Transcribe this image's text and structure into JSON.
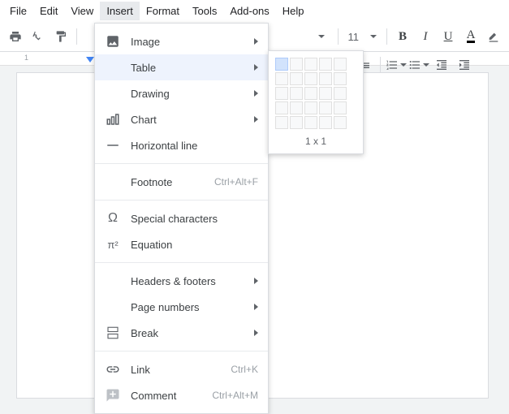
{
  "menubar": [
    "File",
    "Edit",
    "View",
    "Insert",
    "Format",
    "Tools",
    "Add-ons",
    "Help"
  ],
  "active_menu_index": 3,
  "toolbar": {
    "font_size": "11"
  },
  "insert_menu": {
    "items": [
      {
        "icon": "image",
        "label": "Image",
        "submenu": true
      },
      {
        "icon": "table",
        "label": "Table",
        "submenu": true,
        "highlight": true
      },
      {
        "icon": "drawing",
        "label": "Drawing",
        "submenu": true
      },
      {
        "icon": "chart",
        "label": "Chart",
        "submenu": true
      },
      {
        "icon": "hr",
        "label": "Horizontal line"
      },
      {
        "sep": true
      },
      {
        "icon": "",
        "label": "Footnote",
        "shortcut": "Ctrl+Alt+F"
      },
      {
        "sep": true
      },
      {
        "icon": "omega",
        "label": "Special characters"
      },
      {
        "icon": "pi",
        "label": "Equation"
      },
      {
        "sep": true
      },
      {
        "icon": "",
        "label": "Headers & footers",
        "submenu": true
      },
      {
        "icon": "",
        "label": "Page numbers",
        "submenu": true
      },
      {
        "icon": "break",
        "label": "Break",
        "submenu": true
      },
      {
        "sep": true
      },
      {
        "icon": "link",
        "label": "Link",
        "shortcut": "Ctrl+K"
      },
      {
        "icon": "comment",
        "label": "Comment",
        "shortcut": "Ctrl+Alt+M"
      }
    ]
  },
  "table_picker": {
    "rows": 5,
    "cols": 5,
    "sel_r": 1,
    "sel_c": 1,
    "label": "1 x 1"
  }
}
